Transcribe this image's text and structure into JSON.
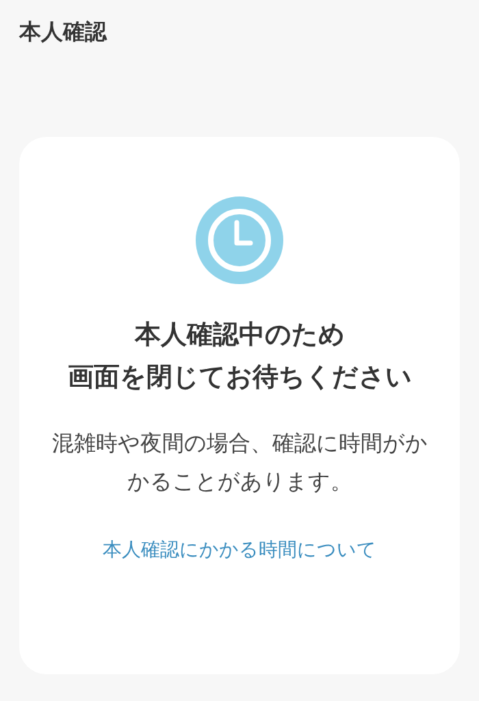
{
  "header": {
    "title": "本人確認"
  },
  "card": {
    "heading_lines": [
      "本人確認中のため",
      "画面を閉じてお待ちください"
    ],
    "message": "混雑時や夜間の場合、確認に時間がかかることがあります。",
    "link": "本人確認にかかる時間について"
  }
}
